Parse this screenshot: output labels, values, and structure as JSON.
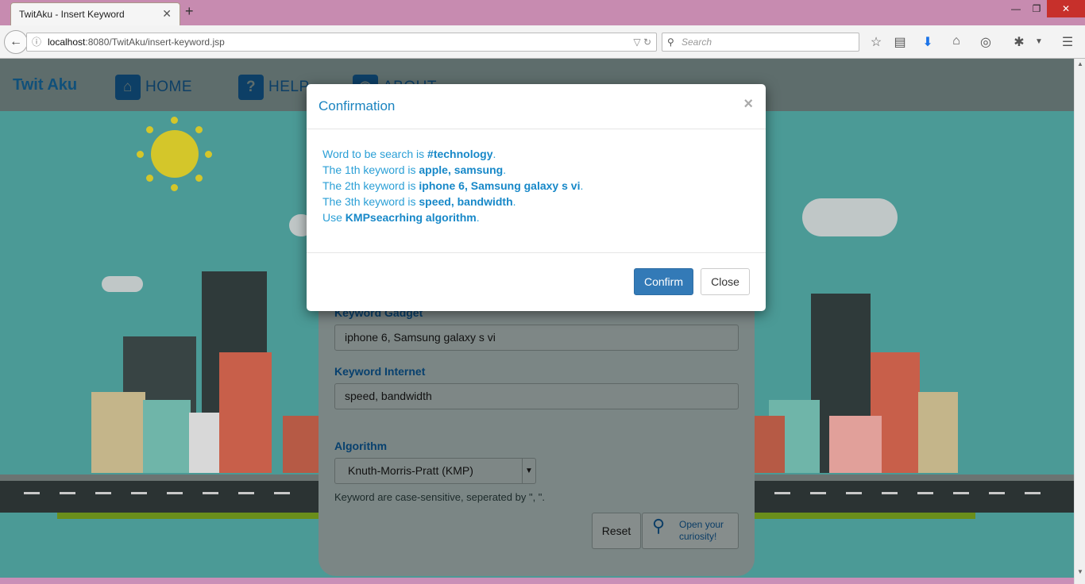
{
  "browser": {
    "tab_title": "TwitAku - Insert Keyword",
    "tab_close": "✕",
    "new_tab": "+",
    "url_host": "localhost",
    "url_rest": ":8080/TwitAku/insert-keyword.jsp",
    "search_placeholder": "Search"
  },
  "navbar": {
    "logo": "Twit Aku",
    "items": [
      {
        "label": "HOME",
        "icon": "home-icon"
      },
      {
        "label": "HELP",
        "icon": "help-icon"
      },
      {
        "label": "ABOUT",
        "icon": "about-icon"
      }
    ]
  },
  "form": {
    "gadget_label": "Keyword Gadget",
    "gadget_value": "iphone 6, Samsung galaxy s vi",
    "internet_label": "Keyword Internet",
    "internet_value": "speed, bandwidth",
    "algorithm_label": "Algorithm",
    "algorithm_value": "Knuth-Morris-Pratt (KMP)",
    "hint": "Keyword are case-sensitive, seperated by \", \".",
    "reset_label": "Reset",
    "open_line1": "Open your",
    "open_line2": "curiosity!"
  },
  "modal": {
    "title": "Confirmation",
    "close_symbol": "×",
    "lines": [
      {
        "prefix": "Word to be search is ",
        "value": "#technology",
        "suffix": "."
      },
      {
        "prefix": "The 1th keyword is ",
        "value": "apple, samsung",
        "suffix": "."
      },
      {
        "prefix": "The 2th keyword is ",
        "value": "iphone 6, Samsung galaxy s vi",
        "suffix": "."
      },
      {
        "prefix": "The 3th keyword is ",
        "value": "speed, bandwidth",
        "suffix": "."
      },
      {
        "prefix": "Use ",
        "value": "KMPseacrhing algorithm",
        "suffix": "."
      }
    ],
    "confirm_label": "Confirm",
    "close_label": "Close"
  },
  "colors": {
    "accent": "#337ab7",
    "modal_text": "#2a9fd6",
    "titlebar": "#c78bb0"
  }
}
